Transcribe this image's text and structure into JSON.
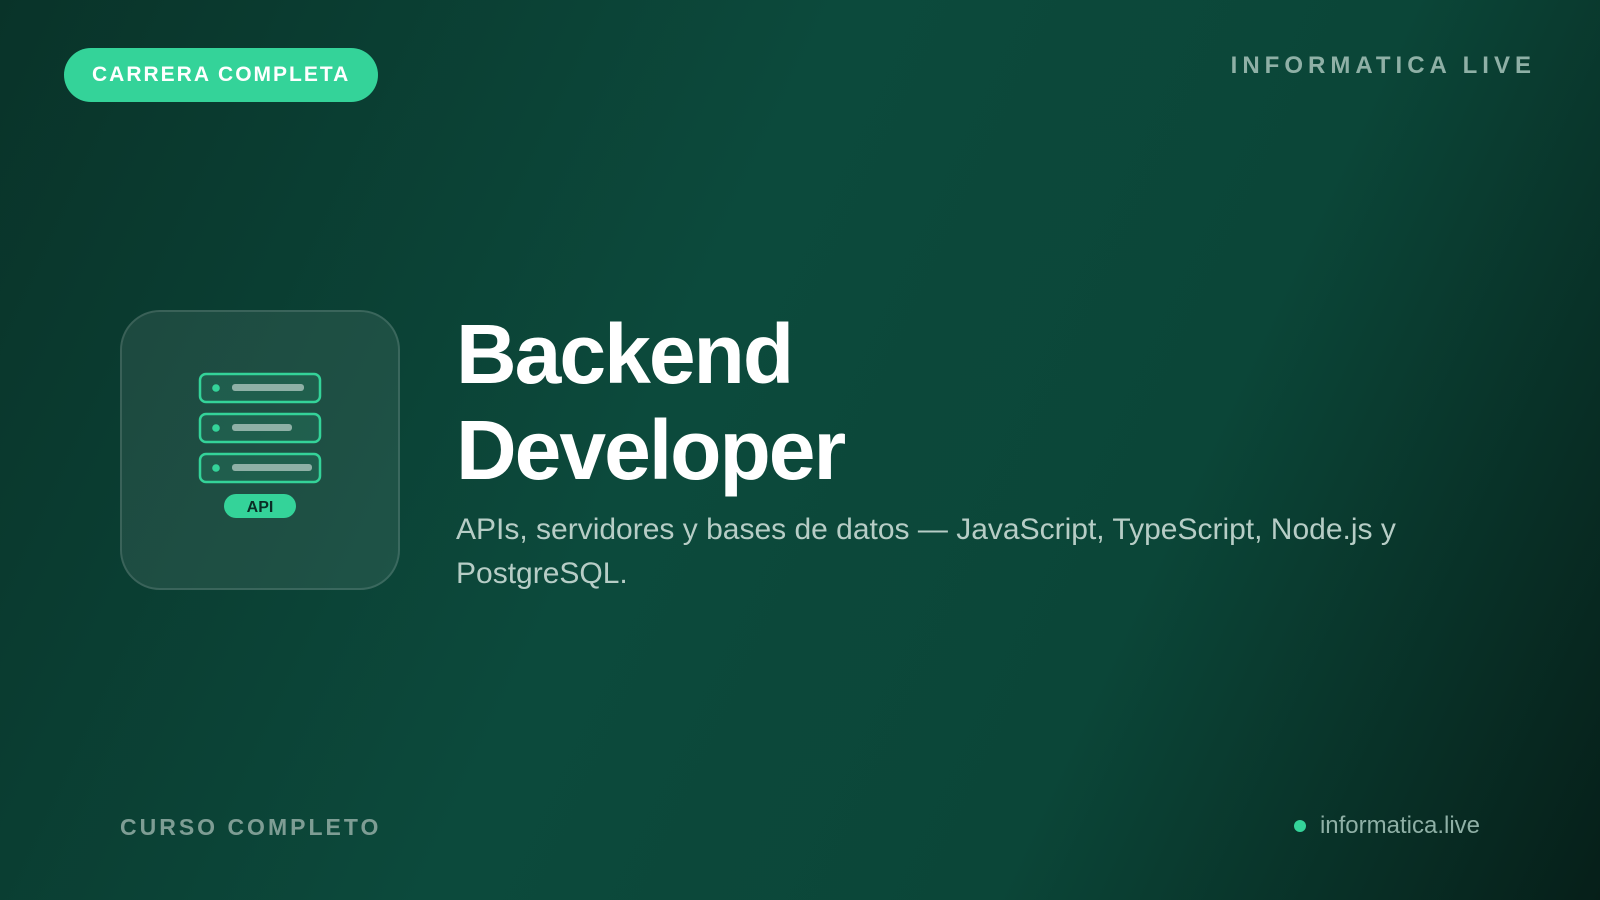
{
  "badge": {
    "label": "CARRERA COMPLETA"
  },
  "brand": {
    "name": "INFORMATICA LIVE"
  },
  "icon": {
    "name": "server-api-icon",
    "api_label": "API"
  },
  "hero": {
    "title_line1": "Backend",
    "title_line2": "Developer",
    "subtitle": "APIs, servidores y bases de datos — JavaScript, TypeScript, Node.js y PostgreSQL."
  },
  "footer": {
    "left_label": "CURSO COMPLETO",
    "site": "informatica.live"
  },
  "colors": {
    "accent": "#34d399",
    "background_start": "#093329",
    "background_mid": "#0c4a3c",
    "background_end": "#061f19",
    "muted_text": "#8fb0a6"
  }
}
